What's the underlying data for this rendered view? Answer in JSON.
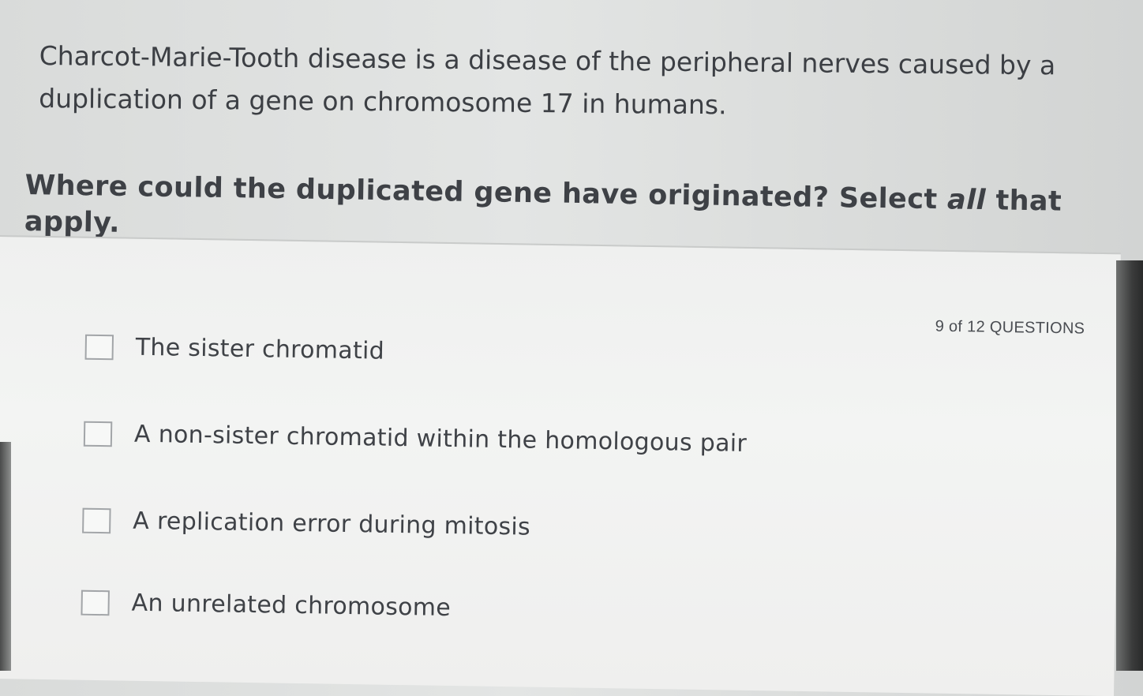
{
  "prompt": {
    "passage": "Charcot-Marie-Tooth disease is a disease of the peripheral nerves caused by a duplication of a gene on chromosome 17 in humans.",
    "question_before": "Where could the duplicated gene have originated? Select ",
    "question_emphasis": "all",
    "question_after": " that apply."
  },
  "progress": {
    "text": "9 of 12 QUESTIONS"
  },
  "options": [
    {
      "label": "The sister chromatid",
      "checked": false
    },
    {
      "label": "A non-sister chromatid within the homologous pair",
      "checked": false
    },
    {
      "label": "A replication error during mitosis",
      "checked": false
    },
    {
      "label": "An unrelated chromosome",
      "checked": false
    }
  ],
  "colors": {
    "text": "#3c3f44",
    "panel": "#f0f1f0",
    "checkbox_border": "#a2a5a8"
  }
}
